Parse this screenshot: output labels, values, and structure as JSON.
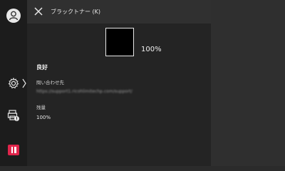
{
  "header": {
    "title": "ブラックトナー (K)"
  },
  "toner": {
    "color_name": "black",
    "swatch_color": "#000000",
    "level_percent": "100%"
  },
  "status": {
    "label": "良好"
  },
  "contact": {
    "label": "問い合わせ先",
    "url": "https://support1.ricohlimitechp.com/support/"
  },
  "remaining": {
    "label": "残量",
    "value": "100%"
  },
  "icons": {
    "avatar": "user-icon",
    "settings": "gear-icon",
    "printer": "printer-info-icon",
    "stop": "pause-icon",
    "close": "close-icon"
  },
  "colors": {
    "stop_button": "#e0254b"
  }
}
